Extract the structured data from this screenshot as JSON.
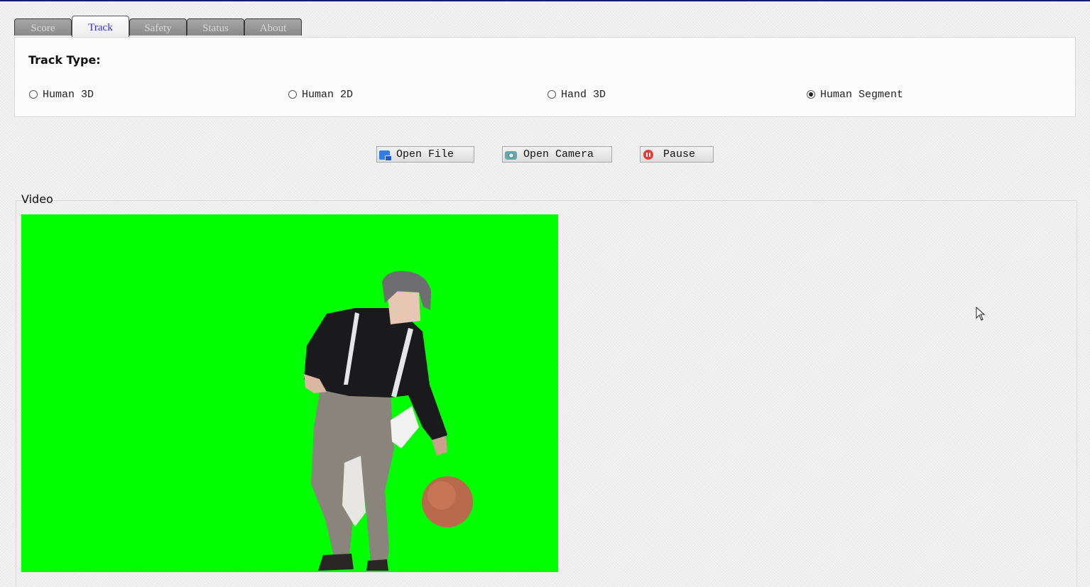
{
  "tabs": [
    {
      "label": "Score",
      "active": false
    },
    {
      "label": "Track",
      "active": true
    },
    {
      "label": "Safety",
      "active": false
    },
    {
      "label": "Status",
      "active": false
    },
    {
      "label": "About",
      "active": false
    }
  ],
  "track_panel": {
    "title": "Track Type:",
    "options": [
      {
        "label": "Human 3D",
        "checked": false
      },
      {
        "label": "Human 2D",
        "checked": false
      },
      {
        "label": "Hand 3D",
        "checked": false
      },
      {
        "label": "Human Segment",
        "checked": true
      }
    ]
  },
  "toolbar": {
    "open_file": "Open File",
    "open_camera": "Open Camera",
    "pause": "Pause"
  },
  "video": {
    "title": "Video",
    "background_color": "#00ff00"
  },
  "colors": {
    "active_tab_text": "#2d2df0",
    "inactive_tab_text": "#d8d8d8",
    "pause_icon": "#e83a3a",
    "file_icon": "#2f7ee8",
    "camera_icon": "#6aa8a8"
  }
}
